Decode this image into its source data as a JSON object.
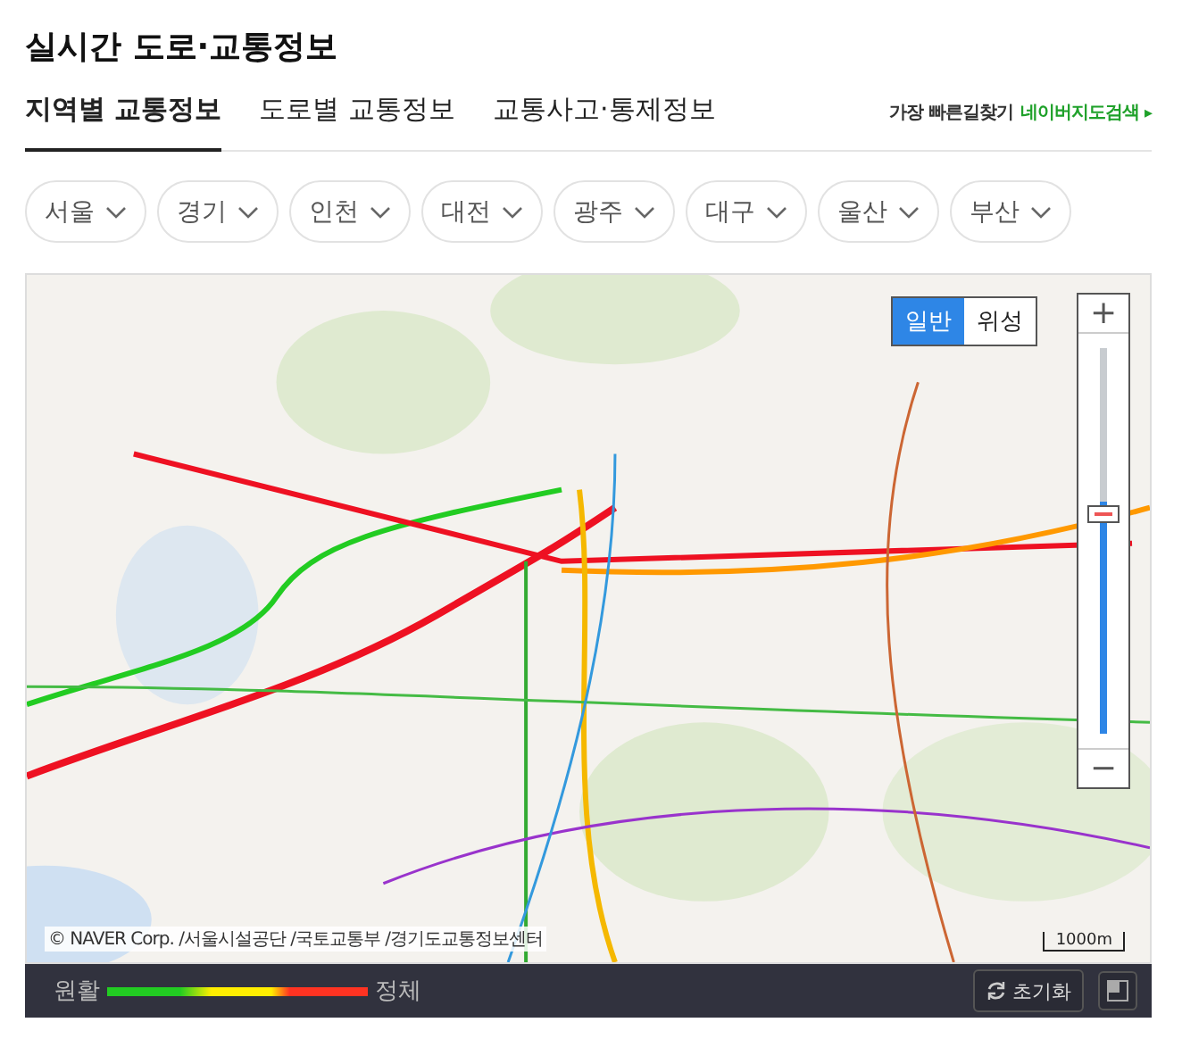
{
  "title": "실시간 도로·교통정보",
  "tabs": [
    {
      "label": "지역별 교통정보",
      "selected": true
    },
    {
      "label": "도로별 교통정보",
      "selected": false
    },
    {
      "label": "교통사고·통제정보",
      "selected": false
    }
  ],
  "route_link": {
    "prefix": "가장 빠른길찾기",
    "link": "네이버지도검색",
    "arrow": "▸"
  },
  "regions": [
    {
      "label": "서울",
      "expanded": false
    },
    {
      "label": "경기",
      "expanded": false
    },
    {
      "label": "인천",
      "expanded": false
    },
    {
      "label": "대전",
      "expanded": false
    },
    {
      "label": "광주",
      "expanded": false
    },
    {
      "label": "대구",
      "expanded": false
    },
    {
      "label": "울산",
      "expanded": false
    },
    {
      "label": "부산",
      "expanded": false
    }
  ],
  "map": {
    "map_types": [
      {
        "label": "일반",
        "selected": true
      },
      {
        "label": "위성",
        "selected": false
      }
    ],
    "zoom": {
      "plus": "+",
      "minus": "−",
      "level": 0.57
    },
    "copyright": "© NAVER Corp. /서울시설공단 /국토교통부 /경기도교통정보센터",
    "scale": "1000m"
  },
  "legend": {
    "smooth": "원활",
    "congested": "정체"
  },
  "reset_button": "초기화"
}
